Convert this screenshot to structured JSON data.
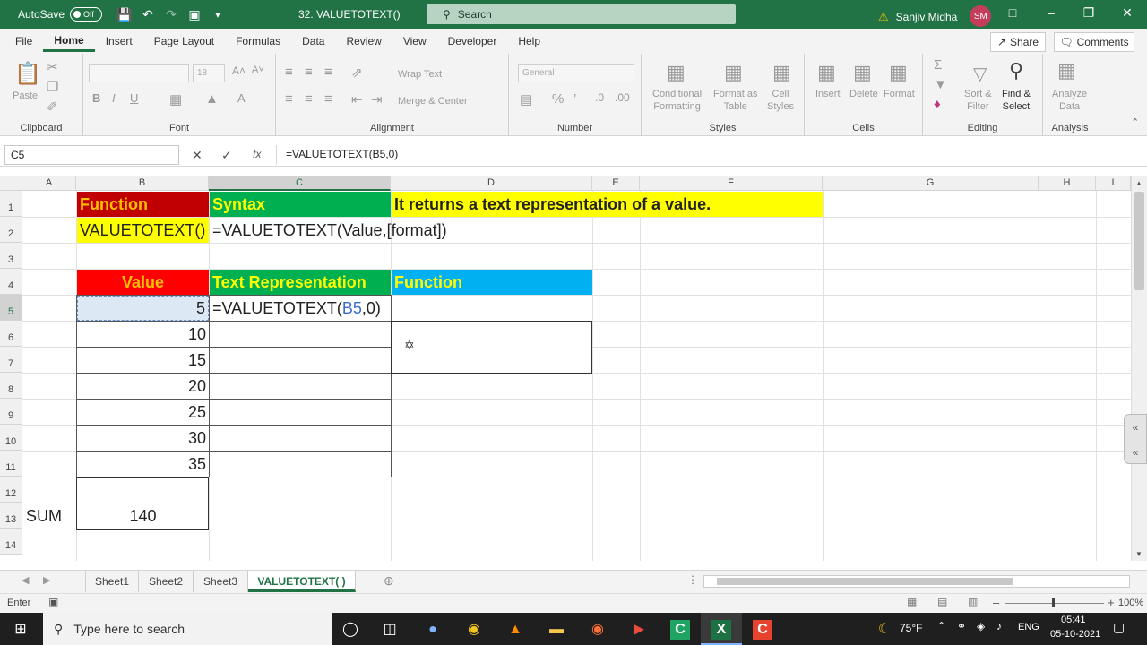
{
  "titlebar": {
    "autosave_label": "AutoSave",
    "autosave_state": "Off",
    "doc_title": "32. VALUETOTEXT()",
    "search_placeholder": "Search",
    "user_name": "Sanjiv Midha",
    "user_initials": "SM"
  },
  "menu": [
    "File",
    "Home",
    "Insert",
    "Page Layout",
    "Formulas",
    "Data",
    "Review",
    "View",
    "Developer",
    "Help"
  ],
  "menu_active": "Home",
  "share_label": "Share",
  "comments_label": "Comments",
  "ribbon": {
    "clipboard": {
      "label": "Clipboard",
      "paste": "Paste"
    },
    "font": {
      "label": "Font",
      "size": "18"
    },
    "alignment": {
      "label": "Alignment",
      "wrap": "Wrap Text",
      "merge": "Merge & Center"
    },
    "number": {
      "label": "Number",
      "format": "General"
    },
    "styles": {
      "label": "Styles",
      "conditional": "Conditional",
      "conditional2": "Formatting",
      "format_as": "Format as",
      "format_as2": "Table",
      "cell": "Cell",
      "cell2": "Styles"
    },
    "cells": {
      "label": "Cells",
      "insert": "Insert",
      "delete": "Delete",
      "format": "Format"
    },
    "editing": {
      "label": "Editing",
      "sort": "Sort &",
      "sort2": "Filter",
      "find": "Find &",
      "find2": "Select"
    },
    "analysis": {
      "label": "Analysis",
      "analyze": "Analyze",
      "analyze2": "Data"
    }
  },
  "formula_bar": {
    "name_box": "C5",
    "formula": "=VALUETOTEXT(B5,0)"
  },
  "columns": [
    "A",
    "B",
    "C",
    "D",
    "E",
    "F",
    "G",
    "H",
    "I"
  ],
  "rows": [
    "1",
    "2",
    "3",
    "4",
    "5",
    "6",
    "7",
    "8",
    "9",
    "10",
    "11",
    "12",
    "13",
    "14"
  ],
  "cells": {
    "b1": "Function",
    "c1": "Syntax",
    "d1": "It returns a text representation of a value.",
    "b2": "VALUETOTEXT()",
    "c2": "=VALUETOTEXT(Value,[format])",
    "b4": "Value",
    "c4": "Text Representation",
    "d4": "Function",
    "b5": "5",
    "c5_pre": "=VALUETOTEXT(",
    "c5_ref": "B5",
    "c5_post": ",0)",
    "b6": "10",
    "b7": "15",
    "b8": "20",
    "b9": "25",
    "b10": "30",
    "b11": "35",
    "a13": "SUM",
    "b13": "140"
  },
  "sheets": [
    "Sheet1",
    "Sheet2",
    "Sheet3",
    "VALUETOTEXT( )"
  ],
  "active_sheet": "VALUETOTEXT( )",
  "status": {
    "mode": "Enter",
    "zoom": "100%"
  },
  "taskbar": {
    "search_placeholder": "Type here to search",
    "weather": "75°F",
    "lang": "ENG",
    "time": "05:41",
    "date": "05-10-2021"
  },
  "colors": {
    "excel_green": "#217346",
    "red": "#c00000",
    "green": "#00b050",
    "yellow": "#ffff00",
    "blue": "#00b0f0",
    "orange_text": "#ffc000"
  }
}
